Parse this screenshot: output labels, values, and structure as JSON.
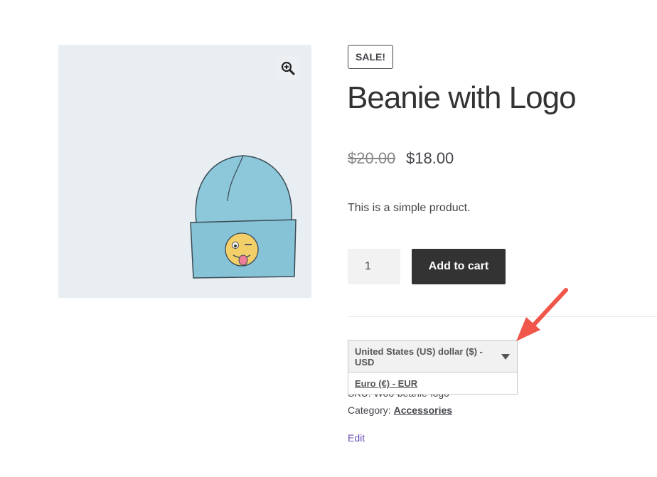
{
  "badge": {
    "sale": "SALE!"
  },
  "product": {
    "title": "Beanie with Logo",
    "price_old": "$20.00",
    "price_new": "$18.00",
    "short_description": "This is a simple product."
  },
  "cart": {
    "quantity": "1",
    "add_label": "Add to cart"
  },
  "currency": {
    "selected": "United States (US) dollar ($) - USD",
    "options": [
      "Euro (€) - EUR"
    ]
  },
  "meta": {
    "sku_partial": "SKU: Woo-beanie-logo",
    "category_label": "Category:",
    "category_value": "Accessories",
    "edit_label": "Edit"
  },
  "icons": {
    "zoom": "zoom-in-icon",
    "caret": "caret-down-icon",
    "arrow": "annotation-arrow"
  },
  "colors": {
    "button_bg": "#333333",
    "image_bg": "#e8eef2",
    "arrow": "#f0574a",
    "link": "#6b4fb3",
    "beanie": "#8cc8da"
  }
}
